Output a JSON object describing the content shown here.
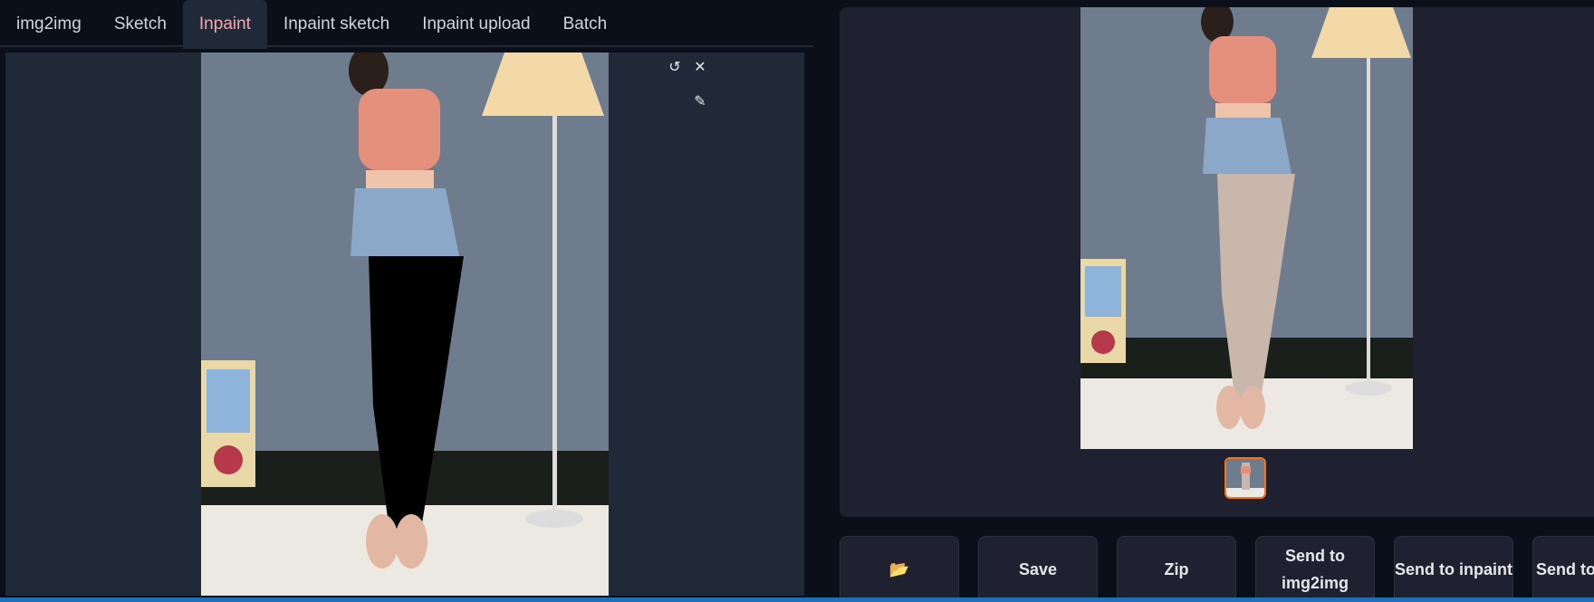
{
  "tabs": [
    {
      "label": "img2img"
    },
    {
      "label": "Sketch"
    },
    {
      "label": "Inpaint"
    },
    {
      "label": "Inpaint sketch"
    },
    {
      "label": "Inpaint upload"
    },
    {
      "label": "Batch"
    }
  ],
  "active_tab": "Inpaint",
  "canvas": {
    "icons": [
      "undo-icon",
      "close-icon",
      "brush-icon"
    ]
  },
  "actions": [
    {
      "label": "📂",
      "icon": "folder-icon"
    },
    {
      "label": "Save"
    },
    {
      "label": "Zip"
    },
    {
      "label": "Send to img2img"
    },
    {
      "label": "Send to inpaint"
    },
    {
      "label": "Send to extras"
    }
  ],
  "colors": {
    "accent_tab": "#f8a4b2",
    "thumb_border": "#f97316",
    "panel": "#1f2937",
    "bg": "#0b0f19"
  }
}
